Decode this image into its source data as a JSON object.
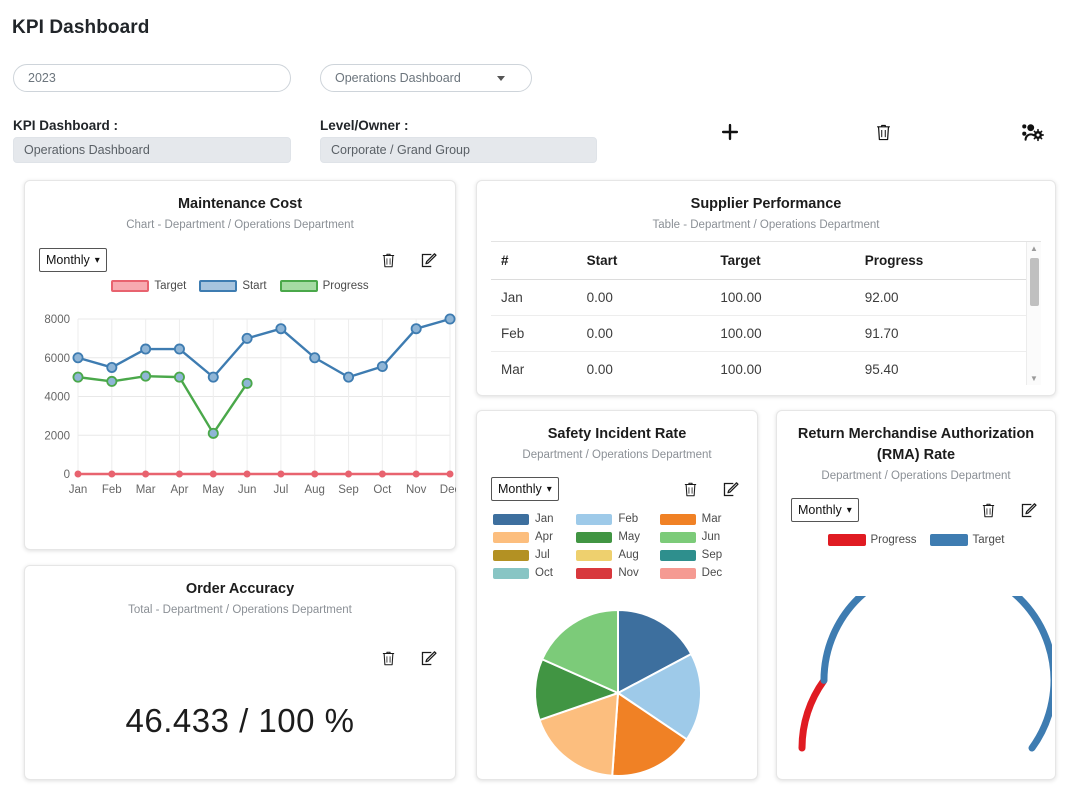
{
  "header": {
    "title": "KPI Dashboard",
    "year_value": "2023",
    "dashboard_select_value": "Operations Dashboard",
    "kpi_dashboard_label": "KPI Dashboard :",
    "kpi_dashboard_value": "Operations Dashboard",
    "level_owner_label": "Level/Owner :",
    "level_owner_value": "Corporate / Grand Group",
    "icons": {
      "add": "plus-icon",
      "delete": "trash-icon",
      "users": "users-gear-icon"
    }
  },
  "cards": {
    "maintenance_cost": {
      "title": "Maintenance Cost",
      "subtitle": "Chart - Department / Operations Department",
      "period": "Monthly",
      "delete_icon": "trash-icon",
      "edit_icon": "edit-icon"
    },
    "supplier_performance": {
      "title": "Supplier Performance",
      "subtitle": "Table - Department / Operations Department",
      "columns": [
        "#",
        "Start",
        "Target",
        "Progress"
      ],
      "rows": [
        [
          "Jan",
          "0.00",
          "100.00",
          "92.00"
        ],
        [
          "Feb",
          "0.00",
          "100.00",
          "91.70"
        ],
        [
          "Mar",
          "0.00",
          "100.00",
          "95.40"
        ]
      ]
    },
    "safety_incident_rate": {
      "title": "Safety Incident Rate",
      "subtitle": "Department / Operations Department",
      "period": "Monthly",
      "delete_icon": "trash-icon",
      "edit_icon": "edit-icon"
    },
    "rma_rate": {
      "title_line1": "Return Merchandise Authorization",
      "title_line2": "(RMA) Rate",
      "subtitle": "Department / Operations Department",
      "period": "Monthly",
      "delete_icon": "trash-icon",
      "edit_icon": "edit-icon"
    },
    "order_accuracy": {
      "title": "Order Accuracy",
      "subtitle": "Total - Department / Operations Department",
      "value": "46.433 / 100 %",
      "delete_icon": "trash-icon",
      "edit_icon": "edit-icon"
    }
  },
  "chart_data": [
    {
      "type": "line",
      "id": "maintenance-cost",
      "title": "Maintenance Cost",
      "xlabel": "",
      "ylabel": "",
      "ylim": [
        0,
        8000
      ],
      "yticks": [
        0,
        2000,
        4000,
        6000,
        8000
      ],
      "grid": true,
      "legend_position": "top",
      "categories": [
        "Jan",
        "Feb",
        "Mar",
        "Apr",
        "May",
        "Jun",
        "Jul",
        "Aug",
        "Sep",
        "Oct",
        "Nov",
        "Dec"
      ],
      "series": [
        {
          "name": "Target",
          "color": "#e8636f",
          "values": [
            0,
            0,
            0,
            0,
            0,
            0,
            0,
            0,
            0,
            0,
            0,
            0
          ]
        },
        {
          "name": "Start",
          "color": "#3e7cb1",
          "values": [
            6000,
            5500,
            6450,
            6450,
            5000,
            7000,
            7500,
            6000,
            5000,
            5550,
            7500,
            8000
          ]
        },
        {
          "name": "Progress",
          "color": "#4aa84a",
          "values": [
            5000,
            4780,
            5050,
            5000,
            2100,
            4680,
            null,
            null,
            null,
            null,
            null,
            null
          ]
        }
      ]
    },
    {
      "type": "pie",
      "id": "safety-incident-rate",
      "title": "Safety Incident Rate",
      "legend_position": "top",
      "categories": [
        "Jan",
        "Feb",
        "Mar",
        "Apr",
        "May",
        "Jun",
        "Jul",
        "Aug",
        "Sep",
        "Oct",
        "Nov",
        "Dec"
      ],
      "colors": [
        "#3d6f9e",
        "#9ecae9",
        "#f08125",
        "#fcbe7e",
        "#419543",
        "#7ccb79",
        "#b39123",
        "#eed06e",
        "#2e8f8d",
        "#88c5c4",
        "#d8383d",
        "#f59a92"
      ],
      "slices": [
        {
          "label": "Jan",
          "degrees": 62,
          "color": "#3d6f9e"
        },
        {
          "label": "Feb",
          "degrees": 62,
          "color": "#9ecae9"
        },
        {
          "label": "Mar",
          "degrees": 60,
          "color": "#f08125"
        },
        {
          "label": "Apr",
          "degrees": 67,
          "color": "#fcbe7e"
        },
        {
          "label": "May",
          "degrees": 43,
          "color": "#419543"
        },
        {
          "label": "Jun",
          "degrees": 66,
          "color": "#7ccb79"
        }
      ]
    },
    {
      "type": "gauge",
      "id": "rma-rate",
      "title": "Return Merchandise Authorization (RMA) Rate",
      "legend_position": "top",
      "series": [
        {
          "name": "Progress",
          "color": "#e01b22",
          "fraction": 0.2
        },
        {
          "name": "Target",
          "color": "#3e7cb1",
          "fraction": 0.8
        }
      ]
    },
    {
      "type": "table",
      "id": "supplier-performance",
      "title": "Supplier Performance",
      "columns": [
        "#",
        "Start",
        "Target",
        "Progress"
      ],
      "rows": [
        [
          "Jan",
          "0.00",
          "100.00",
          "92.00"
        ],
        [
          "Feb",
          "0.00",
          "100.00",
          "91.70"
        ],
        [
          "Mar",
          "0.00",
          "100.00",
          "95.40"
        ]
      ]
    }
  ]
}
